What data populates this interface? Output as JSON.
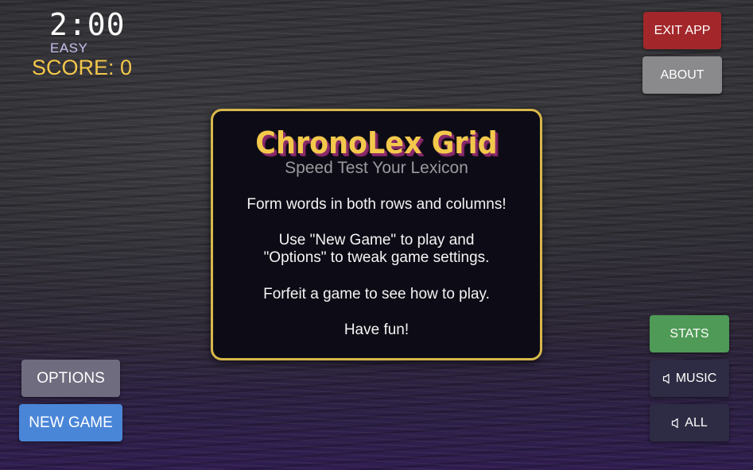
{
  "hud": {
    "timer": "2:00",
    "difficulty": "EASY",
    "score": "SCORE: 0"
  },
  "buttons": {
    "exit_app": "EXIT APP",
    "about": "ABOUT",
    "stats": "STATS",
    "music": "MUSIC",
    "all": "ALL",
    "options": "OPTIONS",
    "new_game": "NEW GAME"
  },
  "icons": {
    "music": "speaker-icon",
    "all": "speaker-icon"
  },
  "dialog": {
    "title": "ChronoLex Grid",
    "subtitle": "Speed Test Your Lexicon",
    "lines": [
      "Form words in both rows and columns!",
      "Use \"New Game\" to play and",
      "\"Options\" to tweak game settings.",
      "Forfeit a game to see how to play.",
      "Have fun!"
    ]
  },
  "colors": {
    "title": "#f3c94c",
    "title_shadow": "#8a2a6b",
    "score": "#f3c74a",
    "difficulty": "#c4c0ee",
    "dialog_border": "#d9b84a",
    "exit_button": "#a3272a",
    "about_button": "#8a8a8c",
    "stats_button": "#4f9a56",
    "sound_buttons": "#2d2c44",
    "options_button": "#6e6c7e",
    "new_game_button": "#4a86d8"
  }
}
